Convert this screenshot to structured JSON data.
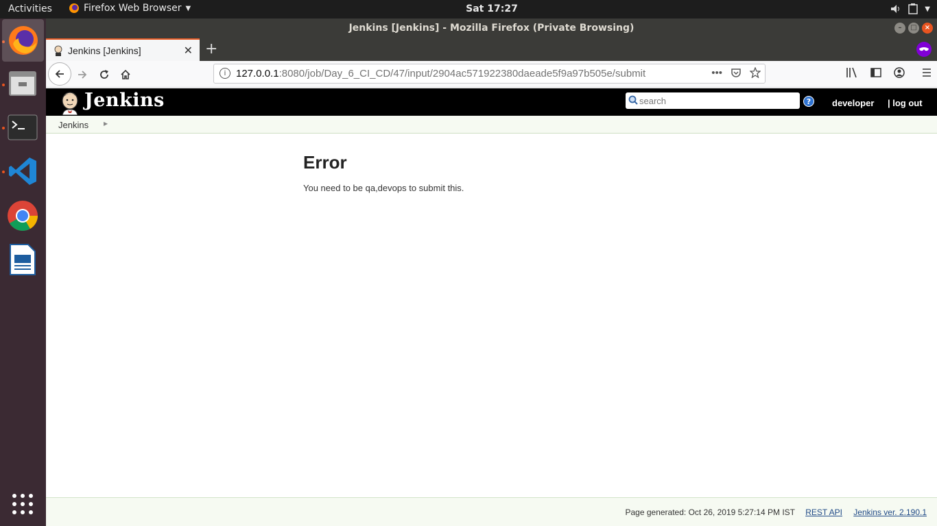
{
  "topbar": {
    "activities": "Activities",
    "app_name": "Firefox Web Browser",
    "clock": "Sat 17:27"
  },
  "dock": {
    "apps": [
      "firefox-icon",
      "files-icon",
      "terminal-icon",
      "vscode-icon",
      "chrome-icon",
      "writer-icon",
      "app-grid-icon"
    ]
  },
  "window": {
    "title": "Jenkins [Jenkins] - Mozilla Firefox (Private Browsing)"
  },
  "tab": {
    "label": "Jenkins [Jenkins]"
  },
  "urlbar": {
    "host": "127.0.0.1",
    "rest": ":8080/job/Day_6_CI_CD/47/input/2904ac571922380daeade5f9a97b505e/submit"
  },
  "jenkins": {
    "logo_text": "Jenkins",
    "search_placeholder": "search",
    "help": "?",
    "user": "developer",
    "logout": "| log out",
    "breadcrumb": "Jenkins",
    "error_title": "Error",
    "error_message": "You need to be qa,devops to submit this.",
    "footer_generated": "Page generated: Oct 26, 2019 5:27:14 PM IST",
    "footer_rest": "REST API",
    "footer_version": "Jenkins ver. 2.190.1"
  },
  "colors": {
    "accent_tab": "#e55b25",
    "private_badge": "#8000d7",
    "jenkins_header": "#000000",
    "link": "#204a87"
  }
}
